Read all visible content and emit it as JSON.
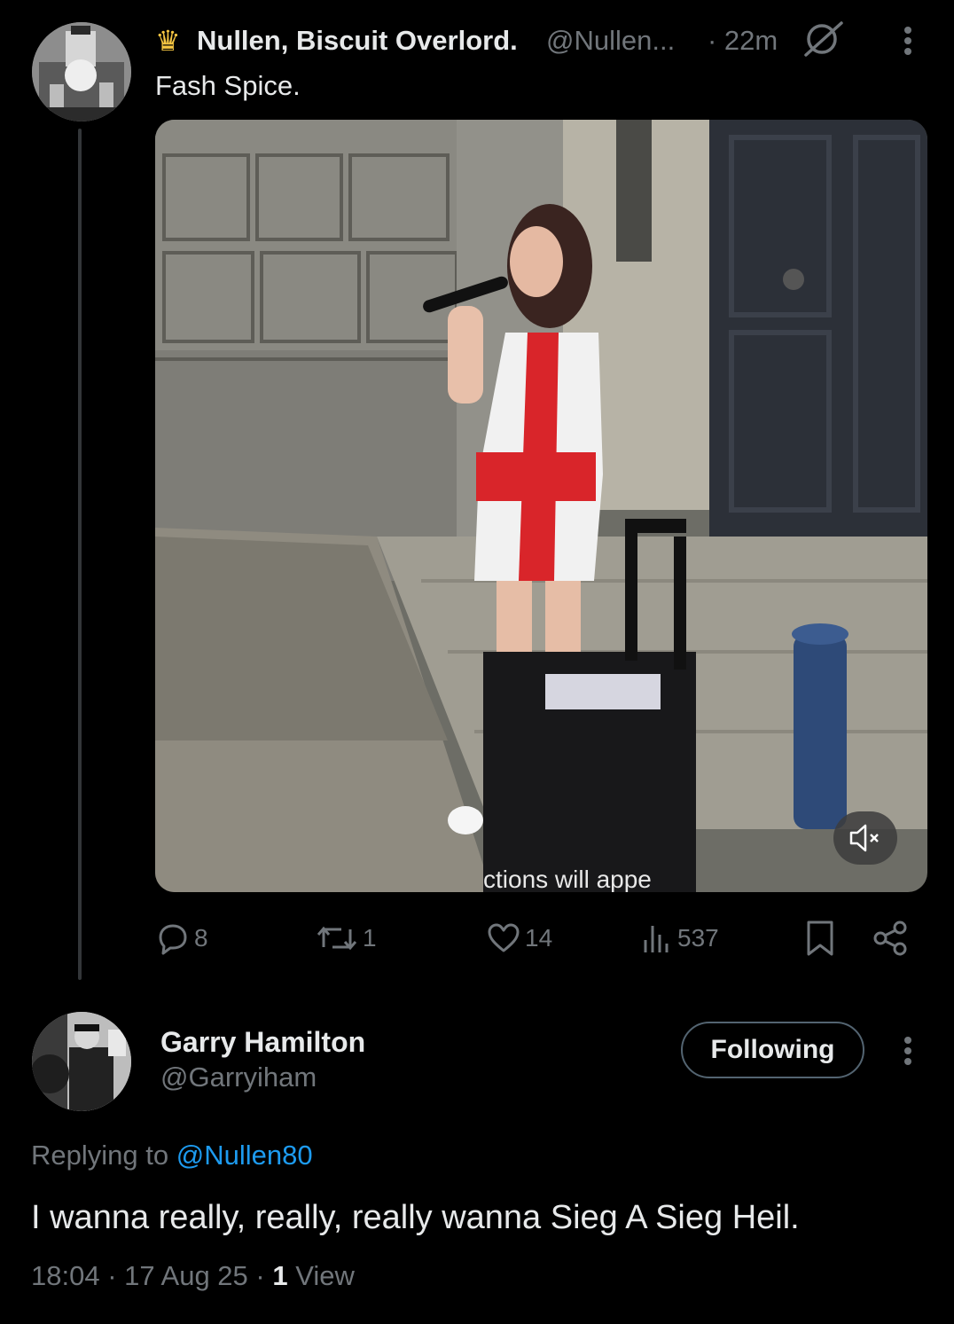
{
  "tweet": {
    "author_name": "Nullen, Biscuit Overlord.",
    "author_handle": "@Nullen...",
    "time": "· 22m",
    "text": "Fash Spice.",
    "video_caption": "ctions will appe",
    "actions": {
      "replies": "8",
      "retweets": "1",
      "likes": "14",
      "views": "537"
    },
    "icons": [
      "crown-emoji",
      "grok-icon",
      "more-icon",
      "reply-icon",
      "retweet-icon",
      "like-icon",
      "views-icon",
      "bookmark-icon",
      "share-icon",
      "mute-icon"
    ]
  },
  "reply": {
    "author_name": "Garry Hamilton",
    "author_handle": "@Garryiham",
    "follow_label": "Following",
    "replying_to_prefix": "Replying to ",
    "replying_to_handle": "@Nullen80",
    "text": "I wanna really, really, really wanna Sieg A Sieg Heil.",
    "time": "18:04",
    "date": "17 Aug 25",
    "view_count": "1",
    "view_label": "View"
  },
  "colors": {
    "background": "#000000",
    "text": "#e7e9ea",
    "secondary": "#71767b",
    "link": "#1d9bf0"
  }
}
